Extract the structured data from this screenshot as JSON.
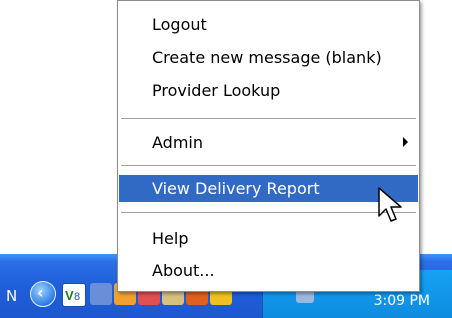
{
  "menu": {
    "items": [
      {
        "label": "Logout"
      },
      {
        "label": "Create new message (blank)"
      },
      {
        "label": "Provider Lookup"
      },
      {
        "label": "Admin"
      },
      {
        "label": "View Delivery Report"
      },
      {
        "label": "Help"
      },
      {
        "label": "About..."
      }
    ]
  },
  "taskbar": {
    "left_label": "N",
    "back_icon": "back-arrow-icon",
    "clock": "3:09 PM"
  },
  "colors": {
    "highlight": "#316ac5",
    "taskbar": "#1f5fd9",
    "tray": "#0e8bdf"
  }
}
